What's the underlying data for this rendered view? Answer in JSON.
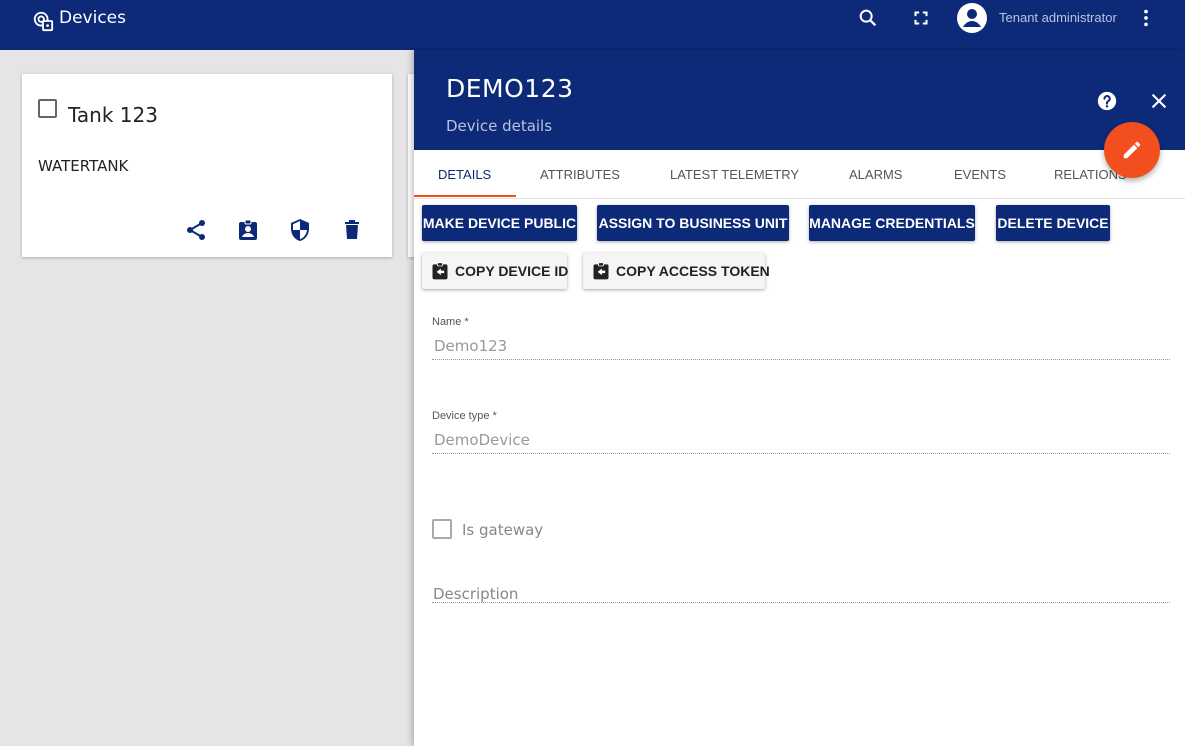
{
  "app": {
    "title": "Devices",
    "user": "Tenant administrator"
  },
  "card": {
    "title": "Tank 123",
    "type": "WATERTANK"
  },
  "details": {
    "title": "DEMO123",
    "subtitle": "Device details",
    "tabs": [
      {
        "label": "DETAILS",
        "active": true
      },
      {
        "label": "ATTRIBUTES",
        "active": false
      },
      {
        "label": "LATEST TELEMETRY",
        "active": false
      },
      {
        "label": "ALARMS",
        "active": false
      },
      {
        "label": "EVENTS",
        "active": false
      },
      {
        "label": "RELATIONS",
        "active": false
      }
    ],
    "actions": {
      "make_public": "MAKE DEVICE PUBLIC",
      "assign_bu": "ASSIGN TO BUSINESS UNIT",
      "manage_credentials": "MANAGE CREDENTIALS",
      "delete_device": "DELETE DEVICE",
      "copy_id": "COPY DEVICE ID",
      "copy_token": "COPY ACCESS TOKEN"
    },
    "form": {
      "name_label": "Name *",
      "name_value": "Demo123",
      "type_label": "Device type *",
      "type_value": "DemoDevice",
      "gateway_label": "Is gateway",
      "gateway_checked": false,
      "description_placeholder": "Description"
    }
  },
  "colors": {
    "primary": "#0d2a78",
    "accent": "#f24e1e"
  }
}
